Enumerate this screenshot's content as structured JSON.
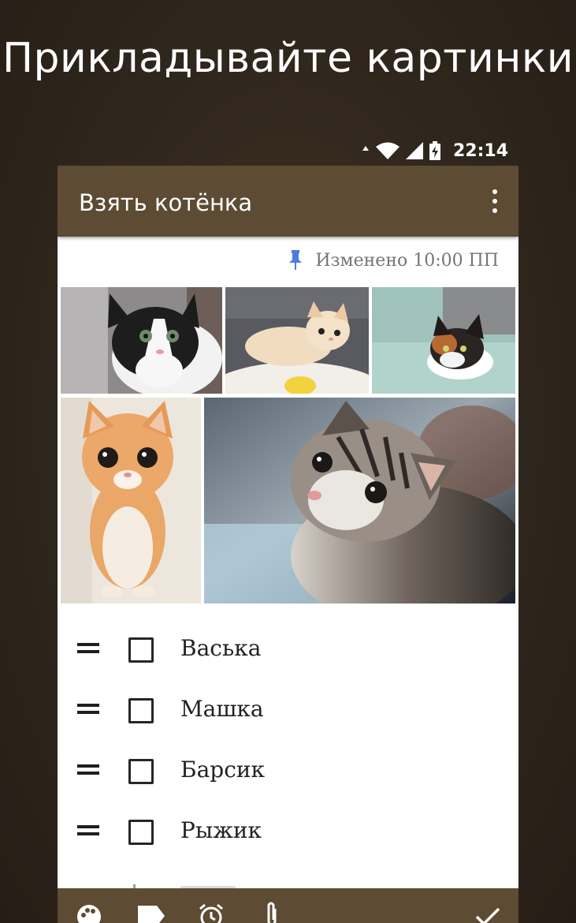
{
  "promo": {
    "title": "Прикладывайте картинки"
  },
  "status_bar": {
    "time": "22:14",
    "icons": [
      "data-arrows-icon",
      "wifi-icon",
      "signal-icon",
      "battery-charging-icon"
    ]
  },
  "note": {
    "title": "Взять котёнка",
    "menu_icon": "more-vert-icon",
    "pin_icon": "pin-icon",
    "edited_label": "Изменено 10:00 ПП",
    "images": [
      {
        "name": "kitten-black-white-photo"
      },
      {
        "name": "kitten-cream-photo"
      },
      {
        "name": "kitten-calico-photo"
      },
      {
        "name": "kitten-ginger-standing-photo"
      },
      {
        "name": "kitten-tabby-photo"
      }
    ],
    "checklist": [
      {
        "label": "Васька",
        "checked": false
      },
      {
        "label": "Машка",
        "checked": false
      },
      {
        "label": "Барсик",
        "checked": false
      },
      {
        "label": "Рыжик",
        "checked": false
      }
    ]
  },
  "bottom_bar": {
    "icons": [
      "palette-icon",
      "label-icon",
      "alarm-icon",
      "attach-icon",
      "done-icon"
    ]
  },
  "colors": {
    "background": "#2f261c",
    "app_bar": "#5d4b33",
    "pin": "#4a7de2",
    "meta_text": "#757575"
  }
}
